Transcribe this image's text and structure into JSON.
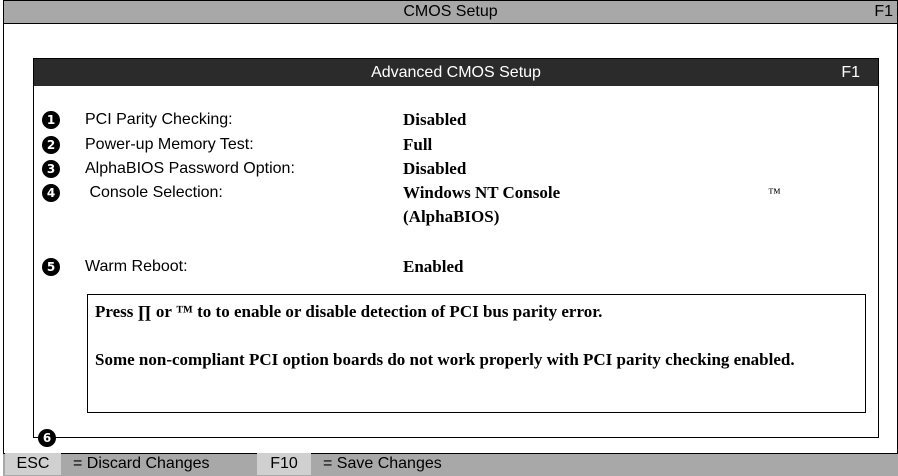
{
  "window": {
    "title": "CMOS Setup",
    "help_key": "F1"
  },
  "panel": {
    "title": "Advanced CMOS Setup",
    "help_key": "F1"
  },
  "settings": [
    {
      "marker": "1",
      "label": "PCI Parity Checking:",
      "value": "Disabled"
    },
    {
      "marker": "2",
      "label": "Power-up Memory Test:",
      "value": "Full"
    },
    {
      "marker": "3",
      "label": "AlphaBIOS Password Option:",
      "value": "Disabled"
    },
    {
      "marker": "4",
      "label": " Console Selection:",
      "value": "Windows NT Console",
      "value_line2": "(AlphaBIOS)",
      "arrow_glyph": "™"
    },
    {
      "marker": "5",
      "label": "Warm Reboot:",
      "value": "Enabled"
    }
  ],
  "help": {
    "line1": "Press ∏ or ™ to to enable or disable detection of PCI bus parity error.",
    "line2": "Some non-compliant PCI option boards do not work properly with PCI parity checking enabled."
  },
  "callout_6": "6",
  "footer": {
    "esc_key": "ESC",
    "esc_desc": "= Discard Changes",
    "f10_key": "F10",
    "f10_desc": "= Save Changes"
  },
  "colors": {
    "bar_gray": "#a8a8a8",
    "panel_head": "#2b2b2b"
  }
}
